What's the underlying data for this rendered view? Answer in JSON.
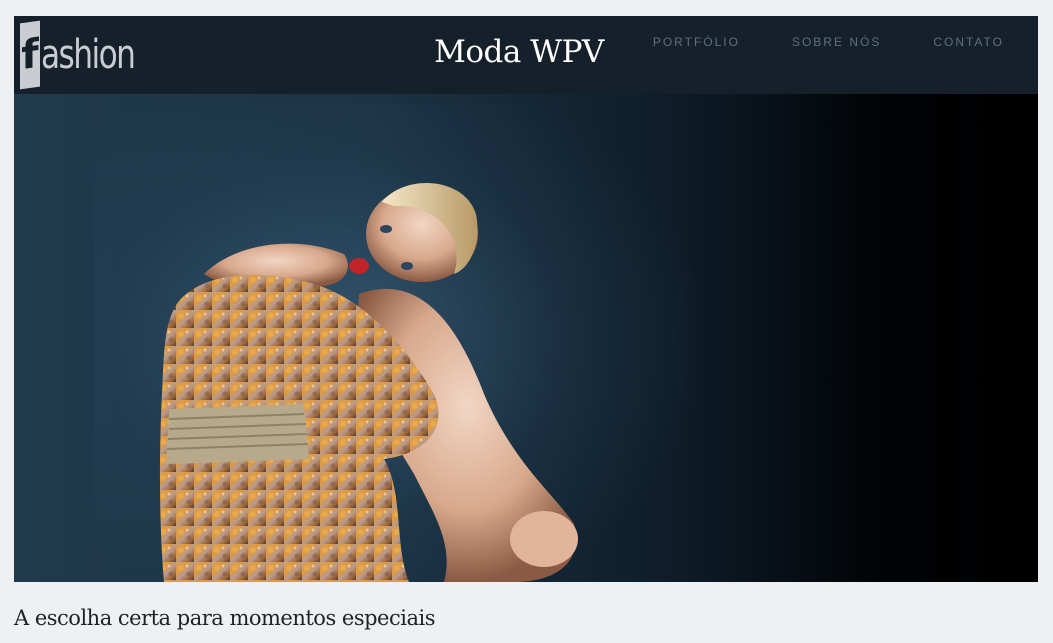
{
  "header": {
    "logo": {
      "first_letter": "f",
      "rest": "ashion"
    },
    "title": "Moda WPV",
    "nav": [
      {
        "label": "PORTFÓLIO"
      },
      {
        "label": "SOBRE NÓS"
      },
      {
        "label": "CONTATO"
      }
    ]
  },
  "hero": {
    "image_name": "fashion-model-hero-image"
  },
  "tagline": "A escolha certa para momentos especiais",
  "colors": {
    "header_bg": "#16202a",
    "page_bg": "#eef0f2",
    "nav_text": "#5d6f80"
  }
}
